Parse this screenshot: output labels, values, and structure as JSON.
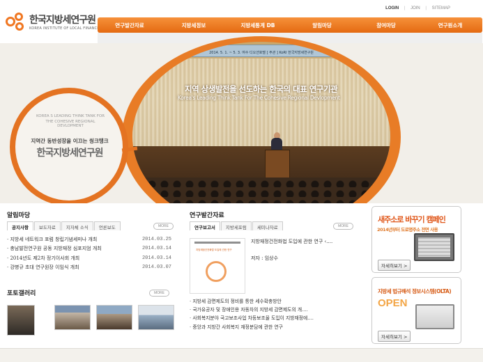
{
  "logo": {
    "name_ko": "한국지방세연구원",
    "name_en": "KOREA INSTITUTE OF LOCAL FINANCE"
  },
  "util": {
    "login": "LOGIN",
    "join": "JOIN",
    "sitemap": "SITEMAP",
    "sep": "|"
  },
  "gnb": {
    "items": [
      "연구발간자료",
      "지방세정보",
      "지방세통계 DB",
      "알림마당",
      "참여마당",
      "연구원소개"
    ]
  },
  "visual": {
    "title_ko": "지역 상생발전을 선도하는 한국의 대표 연구기관",
    "title_en": "Korea's Leading Think Tank For The Cohesive Regional Devlopment",
    "banner_text": "2014. 5. 1. ~ 5. 3.  여수 디오션호텔   [ 주관 ]  KoRI  한국지방세연구원",
    "circle_en1": "KOREA  S LEADING THINK TANK FOR",
    "circle_en2": "THE COHESIVE REGIONAL DEVLOPMENT",
    "circle_ko1": "지역간 동반성장을 이끄는 씽크탱크",
    "circle_ko2": "한국지방세연구원"
  },
  "notice": {
    "title": "알림마당",
    "tabs": [
      "공지사항",
      "보도자료",
      "지자체 소식",
      "언론보도"
    ],
    "more": "MORE",
    "items": [
      {
        "text": "· 지방세 네트워크 포럼 창립기념세미나 개최",
        "date": "2014.03.25"
      },
      {
        "text": "· 충남발전연구원 공동 지방재정 심포지엄 개최",
        "date": "2014.03.14"
      },
      {
        "text": "· 2014년도 제2차 정기이사회 개최",
        "date": "2014.03.14"
      },
      {
        "text": "· 강병규 초대 연구원장 이임식 개최",
        "date": "2014.03.07"
      }
    ]
  },
  "gallery": {
    "title": "포토갤러리",
    "more": "MORE"
  },
  "research": {
    "title": "연구발간자료",
    "tabs": [
      "연구보고서",
      "지방세포럼",
      "세미나자료"
    ],
    "more": "MORE",
    "featured_title": "지방재정건전화법 도입에 관한 연구 ‹....",
    "featured_author": "저자 : 임상수",
    "cover_title": "지방재정건전화법 도입에 관한 연구",
    "items": [
      "· 지방세 감면제도의 정비를 통한 세수확충방안",
      "· 국가유공자 및 장애인용 자동차의 지방세 감면제도의 개....",
      "· 사회복지분야 국고보조사업 차등보조율 도입이 지방재정에....",
      "· 중앙과 지방간 사회복지 재정분담에 관한 연구"
    ]
  },
  "banner1": {
    "title": "새주소로 바꾸기 캠페인",
    "sub": "2014년부터 도로명주소 전면 사용",
    "button": "자세히보기 >"
  },
  "banner2": {
    "title": "지방세 법규해석 정보시스템(OLTA)",
    "open": "OPEN",
    "button": "자세히보기 >"
  }
}
